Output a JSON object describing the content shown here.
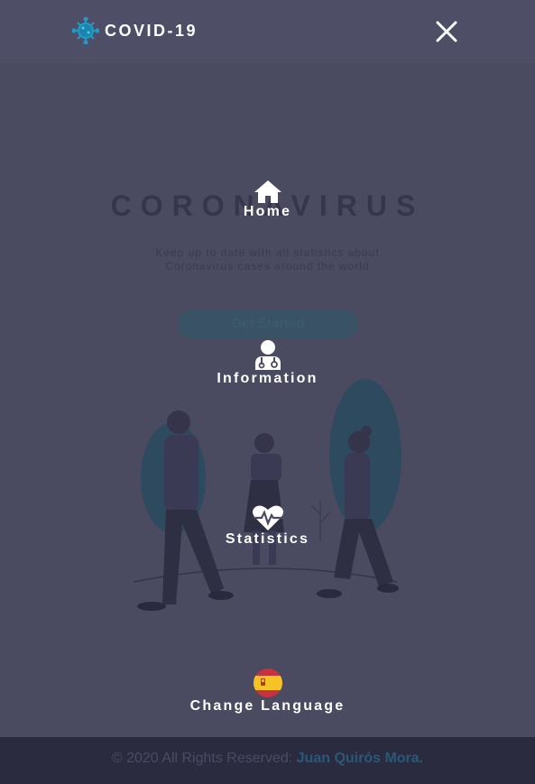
{
  "header": {
    "brand": "COVID-19",
    "brand_icon": "virus-icon",
    "close_icon": "close-icon"
  },
  "hero": {
    "title": "CORONAVIRUS",
    "subtitle_line1": "Keep up to date with all statistics about",
    "subtitle_line2": "Coronavirus cases around the world",
    "button_label": "Get Started"
  },
  "menu": {
    "items": [
      {
        "label": "Home",
        "icon": "home-icon"
      },
      {
        "label": "Information",
        "icon": "doctor-icon"
      },
      {
        "label": "Statistics",
        "icon": "heartbeat-icon"
      },
      {
        "label": "Change Language",
        "icon": "spain-flag-icon"
      }
    ]
  },
  "footer": {
    "text": "© 2020 All Rights Reserved: ",
    "author": "Juan Quirós Mora."
  },
  "colors": {
    "overlay_bg": "#4a4a60",
    "accent": "#2a5877",
    "footer_bg": "#2b2b40"
  }
}
